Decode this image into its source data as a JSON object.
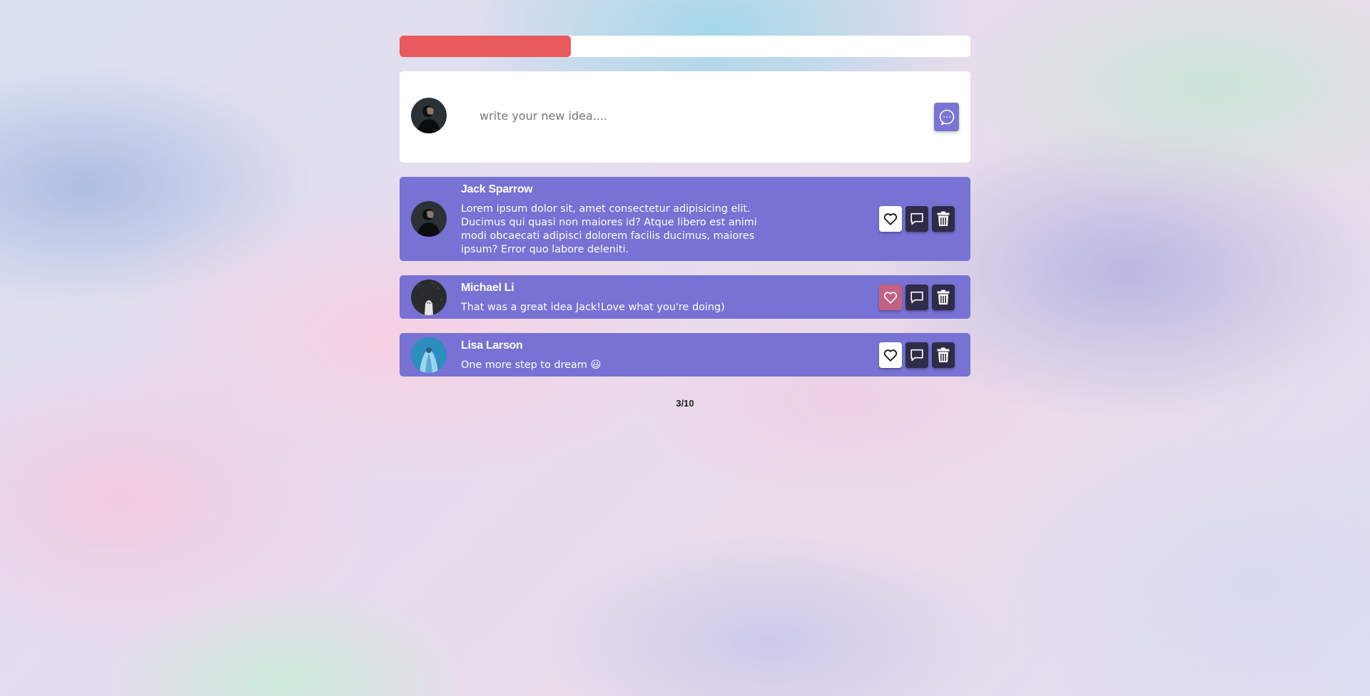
{
  "progress": {
    "value": 0.3,
    "fill_color": "#e85a5c"
  },
  "composer": {
    "placeholder": "write your new idea....",
    "avatar_icon": "user-avatar-dark",
    "send_icon": "chat-bubble-dots-icon",
    "accent": "#7a74d3"
  },
  "posts": [
    {
      "author": "Jack Sparrow",
      "text": "Lorem ipsum dolor sit, amet consectetur adipisicing elit. Ducimus qui quasi non maiores id? Atque libero est animi modi obcaecati adipisci dolorem facilis ducimus, maiores ipsum? Error quo labore deleniti.",
      "liked": false
    },
    {
      "author": "Michael Li",
      "text": "That was a great idea Jack!Love what you're doing)",
      "liked": true
    },
    {
      "author": "Lisa Larson",
      "text": "One more step to dream 😃",
      "liked": false
    }
  ],
  "post_actions": {
    "like_icon": "heart-icon",
    "comment_icon": "comment-icon",
    "delete_icon": "trash-icon"
  },
  "colors": {
    "post_background": "#7772d3",
    "like_active": "#c16283",
    "action_dark": "#2f2c48"
  },
  "counter": "3/10"
}
